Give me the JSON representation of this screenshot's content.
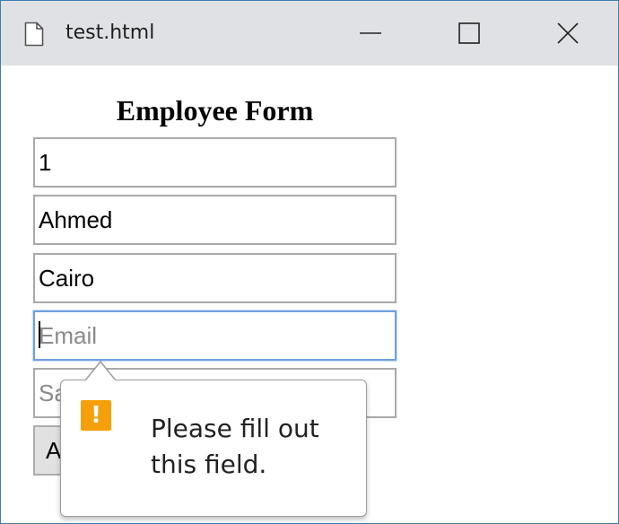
{
  "window": {
    "title": "test.html",
    "buttons": {
      "minimize": "minimize-icon",
      "maximize": "maximize-icon",
      "close": "close-icon"
    }
  },
  "form": {
    "title": "Employee Form",
    "fields": [
      {
        "value": "1",
        "placeholder": ""
      },
      {
        "value": "Ahmed",
        "placeholder": ""
      },
      {
        "value": "Cairo",
        "placeholder": ""
      },
      {
        "value": "",
        "placeholder": "Email"
      },
      {
        "value": "",
        "placeholder": "Salary"
      }
    ],
    "add_button": "Add"
  },
  "tooltip": {
    "message": "Please fill out this field.",
    "icon": "warning-icon",
    "icon_glyph": "!",
    "icon_color": "#f5a00a"
  },
  "colors": {
    "titlebar": "#dfe1e5",
    "focus_border": "#6f9fe0",
    "window_border": "#3c7fb1"
  }
}
